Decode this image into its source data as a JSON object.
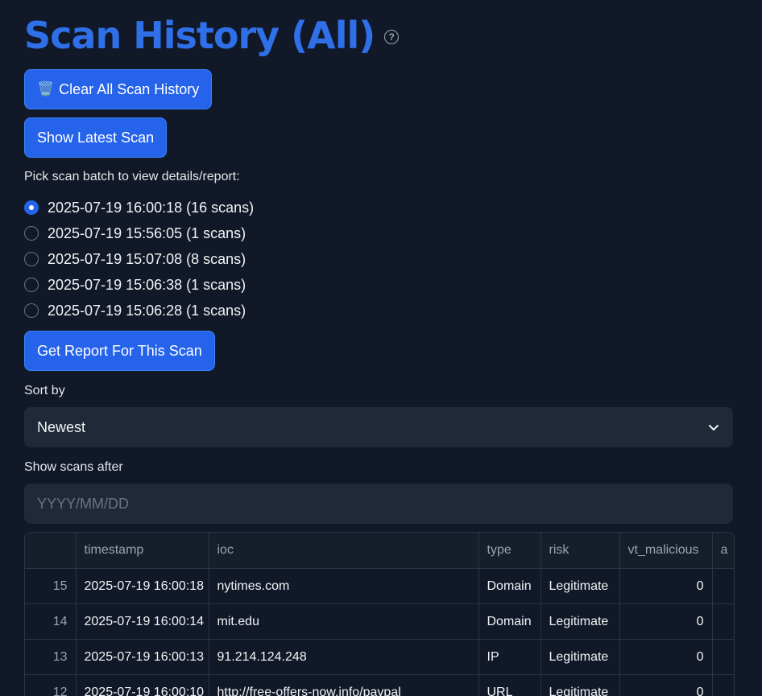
{
  "header": {
    "title": "Scan History (All)",
    "help_icon": "?"
  },
  "actions": {
    "clear_icon": "🗑️",
    "clear_label": "Clear All Scan History",
    "show_latest_label": "Show Latest Scan",
    "get_report_label": "Get Report For This Scan"
  },
  "batch_picker": {
    "label": "Pick scan batch to view details/report:",
    "selected_index": 0,
    "options": [
      "2025-07-19 16:00:18 (16 scans)",
      "2025-07-19 15:56:05 (1 scans)",
      "2025-07-19 15:07:08 (8 scans)",
      "2025-07-19 15:06:38 (1 scans)",
      "2025-07-19 15:06:28 (1 scans)"
    ]
  },
  "sort": {
    "label": "Sort by",
    "value": "Newest"
  },
  "date_filter": {
    "label": "Show scans after",
    "placeholder": "YYYY/MM/DD",
    "value": ""
  },
  "table": {
    "columns": [
      "",
      "timestamp",
      "ioc",
      "type",
      "risk",
      "vt_malicious",
      "a"
    ],
    "rows": [
      [
        "15",
        "2025-07-19 16:00:18",
        "nytimes.com",
        "Domain",
        "Legitimate",
        "0",
        ""
      ],
      [
        "14",
        "2025-07-19 16:00:14",
        "mit.edu",
        "Domain",
        "Legitimate",
        "0",
        ""
      ],
      [
        "13",
        "2025-07-19 16:00:13",
        "91.214.124.248",
        "IP",
        "Legitimate",
        "0",
        ""
      ],
      [
        "12",
        "2025-07-19 16:00:10",
        "http://free-offers-now.info/paypal",
        "URL",
        "Legitimate",
        "0",
        ""
      ]
    ]
  },
  "colors": {
    "background": "#111827",
    "accent": "#2563eb",
    "title": "#2f6fe8",
    "field": "#1f2937"
  }
}
